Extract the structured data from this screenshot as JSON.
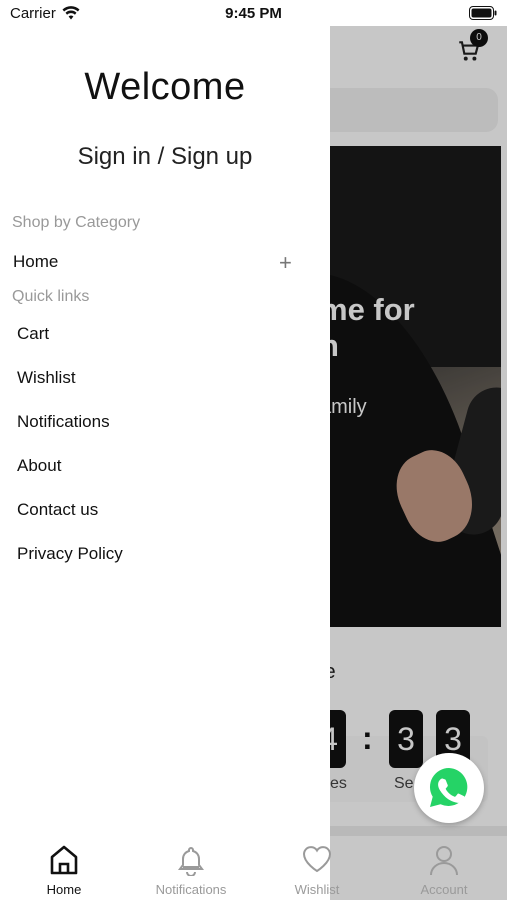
{
  "status_bar": {
    "carrier": "Carrier",
    "time": "9:45 PM"
  },
  "drawer": {
    "title": "Welcome",
    "signin": "Sign in / Sign up",
    "shop_by_category_label": "Shop by Category",
    "categories": [
      {
        "label": "Home",
        "expand_icon": "plus-icon"
      }
    ],
    "quick_links_label": "Quick links",
    "quick_links": [
      "Cart",
      "Wishlist",
      "Notifications",
      "About",
      "Contact us",
      "Privacy Policy"
    ]
  },
  "background": {
    "cart_count": "0",
    "hero_title_fragment": "me for\nn",
    "hero_subtitle_fragment": "amily",
    "sale_fragment": "le",
    "countdown": {
      "digits": [
        "4",
        "3",
        "3"
      ],
      "separator": ":",
      "units": [
        "es",
        "Se"
      ]
    }
  },
  "bottom_nav": [
    {
      "label": "Home",
      "icon": "home-icon",
      "active": true
    },
    {
      "label": "Notifications",
      "icon": "bell-icon",
      "active": false
    },
    {
      "label": "Wishlist",
      "icon": "heart-icon",
      "active": false
    },
    {
      "label": "Account",
      "icon": "person-icon",
      "active": false
    }
  ],
  "colors": {
    "accent": "#111111",
    "whatsapp": "#25D366",
    "muted": "#9a9a9a"
  }
}
